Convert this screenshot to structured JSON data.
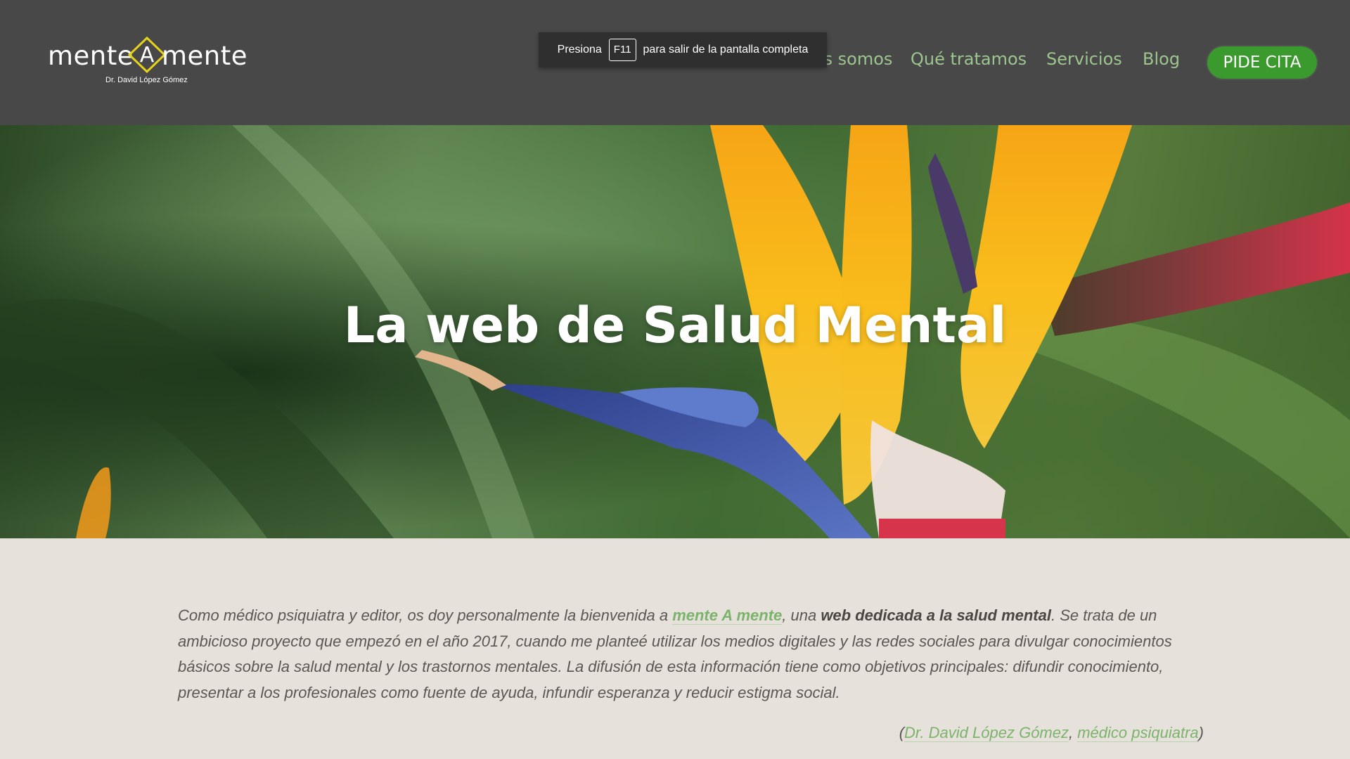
{
  "header": {
    "logo": {
      "word_left": "mente",
      "word_mid": "A",
      "word_right": "mente",
      "subtitle": "Dr. David López Gómez"
    },
    "nav": [
      {
        "label": "Quiénes somos"
      },
      {
        "label": "Qué tratamos"
      },
      {
        "label": "Servicios"
      },
      {
        "label": "Blog"
      }
    ],
    "cta_label": "PIDE CITA"
  },
  "fullscreen_notice": {
    "before": "Presiona",
    "key": "F11",
    "after": "para salir de la pantalla completa"
  },
  "hero": {
    "title": "La web de Salud Mental"
  },
  "intro": {
    "p1": "Como médico psiquiatra y editor, os doy personalmente la bienvenida a ",
    "link_site": "mente A mente",
    "p2": ", una ",
    "bold": "web dedicada a la salud mental",
    "p3": ". Se trata de un ambicioso proyecto que empezó en el año 2017, cuando me planteé utilizar los medios digitales y las redes sociales para divulgar conocimientos básicos sobre la salud mental y los trastornos mentales. La difusión de esta información tiene como objetivos principales: difundir conocimiento, presentar a los profesionales como fuente de ayuda, infundir esperanza y reducir estigma social."
  },
  "signature": {
    "open": "(",
    "author": "Dr. David López Gómez",
    "sep": ", ",
    "role": "médico psiquiatra",
    "close": ")"
  },
  "colors": {
    "header_bg": "#484848",
    "nav_text": "#9dc58f",
    "cta_bg": "#3b9a2d",
    "page_bg": "#e7e1db",
    "link": "#7cb36c",
    "logo_accent": "#e5d21a"
  }
}
